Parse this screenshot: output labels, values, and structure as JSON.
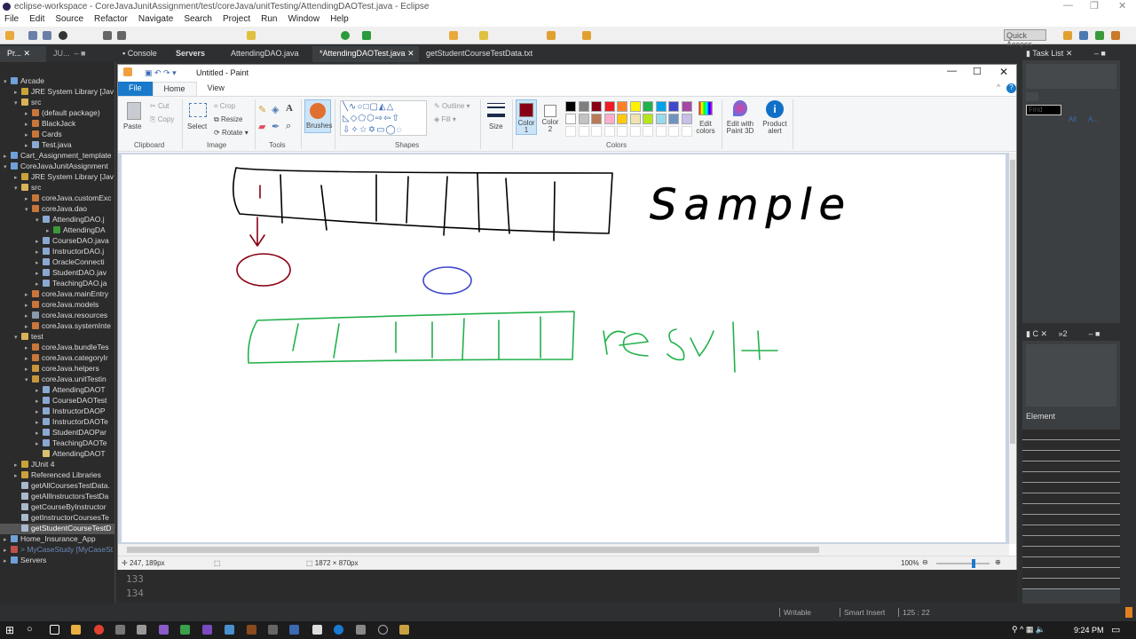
{
  "window": {
    "title": "eclipse-workspace - CoreJavaJunitAssignment/test/coreJava/unitTesting/AttendingDAOTest.java - Eclipse"
  },
  "menu": [
    "File",
    "Edit",
    "Source",
    "Refactor",
    "Navigate",
    "Search",
    "Project",
    "Run",
    "Window",
    "Help"
  ],
  "quick_access": "Quick Access",
  "left_tabs": [
    "Pr...",
    "JU..."
  ],
  "editor_tabs": [
    "Console",
    "Servers",
    "AttendingDAO.java",
    "*AttendingDAOTest.java",
    "getStudentCourseTestData.txt"
  ],
  "tree": [
    {
      "label": "Arcade",
      "depth": 0,
      "arrow": "▾",
      "color": "#6fa0d8"
    },
    {
      "label": "JRE System Library [Jav",
      "depth": 1,
      "arrow": "▸",
      "color": "#c9a33a"
    },
    {
      "label": "src",
      "depth": 1,
      "arrow": "▾",
      "color": "#d9b35a"
    },
    {
      "label": "(default package)",
      "depth": 2,
      "arrow": "▸",
      "color": "#c8763a"
    },
    {
      "label": "BlackJack",
      "depth": 2,
      "arrow": "▸",
      "color": "#c8763a"
    },
    {
      "label": "Cards",
      "depth": 2,
      "arrow": "▸",
      "color": "#c8763a"
    },
    {
      "label": "Test.java",
      "depth": 2,
      "arrow": "▸",
      "color": "#8aa8d0"
    },
    {
      "label": "Cart_Assignment_template",
      "depth": 0,
      "arrow": "▸",
      "color": "#6fa0d8"
    },
    {
      "label": "CoreJavaJunitAssignment",
      "depth": 0,
      "arrow": "▾",
      "color": "#6fa0d8"
    },
    {
      "label": "JRE System Library [Jav",
      "depth": 1,
      "arrow": "▸",
      "color": "#c9a33a"
    },
    {
      "label": "src",
      "depth": 1,
      "arrow": "▾",
      "color": "#d9b35a"
    },
    {
      "label": "coreJava.customExc",
      "depth": 2,
      "arrow": "▸",
      "color": "#c8763a"
    },
    {
      "label": "coreJava.dao",
      "depth": 2,
      "arrow": "▾",
      "color": "#c8763a"
    },
    {
      "label": "AttendingDAO.j",
      "depth": 3,
      "arrow": "▾",
      "color": "#8aa8d0"
    },
    {
      "label": "AttendingDA",
      "depth": 4,
      "arrow": "▸",
      "color": "#3a9a3a"
    },
    {
      "label": "CourseDAO.java",
      "depth": 3,
      "arrow": "▸",
      "color": "#8aa8d0"
    },
    {
      "label": "InstructorDAO.j",
      "depth": 3,
      "arrow": "▸",
      "color": "#8aa8d0"
    },
    {
      "label": "OracleConnecti",
      "depth": 3,
      "arrow": "▸",
      "color": "#8aa8d0"
    },
    {
      "label": "StudentDAO.jav",
      "depth": 3,
      "arrow": "▸",
      "color": "#8aa8d0"
    },
    {
      "label": "TeachingDAO.ja",
      "depth": 3,
      "arrow": "▸",
      "color": "#8aa8d0"
    },
    {
      "label": "coreJava.mainEntry",
      "depth": 2,
      "arrow": "▸",
      "color": "#c8763a"
    },
    {
      "label": "coreJava.models",
      "depth": 2,
      "arrow": "▸",
      "color": "#c8763a"
    },
    {
      "label": "coreJava.resources",
      "depth": 2,
      "arrow": "▸",
      "color": "#8899aa"
    },
    {
      "label": "coreJava.systemInte",
      "depth": 2,
      "arrow": "▸",
      "color": "#c8763a"
    },
    {
      "label": "test",
      "depth": 1,
      "arrow": "▾",
      "color": "#d9b35a"
    },
    {
      "label": "coreJava.bundleTes",
      "depth": 2,
      "arrow": "▸",
      "color": "#c8763a"
    },
    {
      "label": "coreJava.categoryIr",
      "depth": 2,
      "arrow": "▸",
      "color": "#c8763a"
    },
    {
      "label": "coreJava.helpers",
      "depth": 2,
      "arrow": "▸",
      "color": "#c8963a"
    },
    {
      "label": "coreJava.unitTestin",
      "depth": 2,
      "arrow": "▾",
      "color": "#c8963a"
    },
    {
      "label": "AttendingDAOT",
      "depth": 3,
      "arrow": "▸",
      "color": "#8aa8d0"
    },
    {
      "label": "CourseDAOTest",
      "depth": 3,
      "arrow": "▸",
      "color": "#8aa8d0"
    },
    {
      "label": "InstructorDAOP",
      "depth": 3,
      "arrow": "▸",
      "color": "#8aa8d0"
    },
    {
      "label": "InstructorDAOTe",
      "depth": 3,
      "arrow": "▸",
      "color": "#8aa8d0"
    },
    {
      "label": "StudentDAOPar",
      "depth": 3,
      "arrow": "▸",
      "color": "#8aa8d0"
    },
    {
      "label": "TeachingDAOTe",
      "depth": 3,
      "arrow": "▸",
      "color": "#8aa8d0"
    },
    {
      "label": "AttendingDAOT",
      "depth": 3,
      "arrow": "",
      "color": "#d9c070"
    },
    {
      "label": "JUnit 4",
      "depth": 1,
      "arrow": "▸",
      "color": "#c9a33a"
    },
    {
      "label": "Referenced Libraries",
      "depth": 1,
      "arrow": "▸",
      "color": "#c9a33a"
    },
    {
      "label": "getAllCoursesTestData.",
      "depth": 1,
      "arrow": "",
      "color": "#aab8cc"
    },
    {
      "label": "getAllInstructorsTestDa",
      "depth": 1,
      "arrow": "",
      "color": "#aab8cc"
    },
    {
      "label": "getCourseByInstructor",
      "depth": 1,
      "arrow": "",
      "color": "#aab8cc"
    },
    {
      "label": "getInstructorCoursesTe",
      "depth": 1,
      "arrow": "",
      "color": "#aab8cc"
    },
    {
      "label": "getStudentCourseTestD",
      "depth": 1,
      "arrow": "",
      "color": "#aab8cc",
      "selected": true
    },
    {
      "label": "Home_Insurance_App",
      "depth": 0,
      "arrow": "▸",
      "color": "#6fa0d8"
    },
    {
      "label": "> MyCaseStudy [MyCaseSt",
      "depth": 0,
      "arrow": "▸",
      "color": "#c0504d",
      "muted": true
    },
    {
      "label": "Servers",
      "depth": 0,
      "arrow": "▸",
      "color": "#6fa0d8"
    }
  ],
  "paint": {
    "title": "Untitled - Paint",
    "tabs": [
      "File",
      "Home",
      "View"
    ],
    "clipboard": {
      "paste": "Paste",
      "cut": "Cut",
      "copy": "Copy",
      "group": "Clipboard"
    },
    "image": {
      "select": "Select",
      "crop": "Crop",
      "resize": "Resize",
      "rotate": "Rotate",
      "group": "Image"
    },
    "tools": {
      "group": "Tools"
    },
    "brushes": "Brushes",
    "shapes": {
      "outline": "Outline",
      "fill": "Fill",
      "group": "Shapes"
    },
    "size": "Size",
    "color1": {
      "label": "Color 1",
      "value": "#880015"
    },
    "color2": {
      "label": "Color 2",
      "value": "#ffffff"
    },
    "palette": [
      "#000000",
      "#7f7f7f",
      "#880015",
      "#ed1c24",
      "#ff7f27",
      "#fff200",
      "#22b14c",
      "#00a2e8",
      "#3f48cc",
      "#a349a4",
      "#ffffff",
      "#c3c3c3",
      "#b97a57",
      "#ffaec9",
      "#ffc90e",
      "#efe4b0",
      "#b5e61d",
      "#99d9ea",
      "#7092be",
      "#c8bfe7"
    ],
    "edit_colors": "Edit colors",
    "paint3d": "Edit with Paint 3D",
    "product_alert": "Product alert",
    "colors_group": "Colors",
    "handwriting": [
      "Sample",
      "result"
    ],
    "status": {
      "cursor": "247, 189px",
      "size": "1872 × 870px",
      "zoom": "100%",
      "zoom_value": 100
    }
  },
  "editor": {
    "lines": [
      "133",
      "134"
    ]
  },
  "right": {
    "task_list": "Task List",
    "find": "Find",
    "all": "All",
    "a": "A...",
    "outline_tab": "C",
    "element": "Element"
  },
  "status": {
    "writable": "Writable",
    "insert": "Smart Insert",
    "pos": "125 : 22"
  },
  "taskbar": {
    "time": "9:24 PM"
  }
}
